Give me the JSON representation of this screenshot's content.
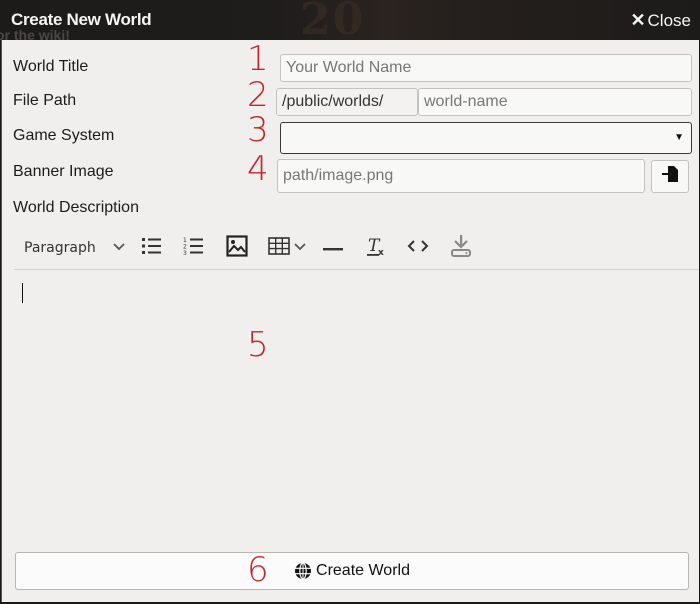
{
  "window": {
    "title": "Create New World",
    "close_label": "Close",
    "background_text": "or the wiki!",
    "header_decoration_text": "20"
  },
  "form": {
    "world_title": {
      "label": "World Title",
      "placeholder": "Your World Name",
      "value": "",
      "annotation": "1"
    },
    "file_path": {
      "label": "File Path",
      "prefix": "/public/worlds/",
      "placeholder": "world-name",
      "value": "",
      "annotation": "2"
    },
    "game_system": {
      "label": "Game System",
      "selected": "",
      "annotation": "3"
    },
    "banner_image": {
      "label": "Banner Image",
      "placeholder": "path/image.png",
      "value": "",
      "browse_icon": "file-import-icon",
      "annotation": "4"
    },
    "world_description": {
      "label": "World Description",
      "annotation": "5",
      "content": ""
    }
  },
  "toolbar": {
    "paragraph_label": "Paragraph",
    "items": [
      {
        "name": "bullet-list-icon"
      },
      {
        "name": "numbered-list-icon"
      },
      {
        "name": "image-icon"
      },
      {
        "name": "table-icon"
      },
      {
        "name": "horizontal-rule-icon"
      },
      {
        "name": "clear-formatting-icon"
      },
      {
        "name": "code-icon"
      },
      {
        "name": "save-icon"
      }
    ]
  },
  "submit": {
    "label": "Create World",
    "icon": "globe-icon",
    "annotation": "6"
  },
  "colors": {
    "annotation_red": "#c0272d",
    "header_bg": "#1c1b1a",
    "content_bg": "#f0efed"
  }
}
